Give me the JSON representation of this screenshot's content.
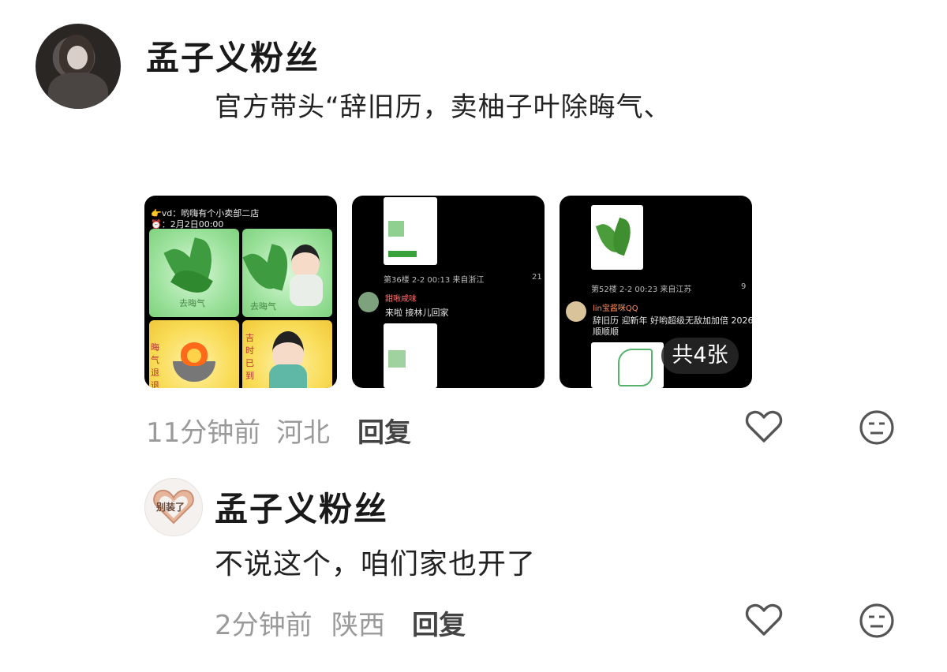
{
  "comments": [
    {
      "username": "孟子义粉丝",
      "text": "官方带头“辞旧历，卖柚子叶除晦气、",
      "time": "11分钟前",
      "location": "河北",
      "reply_label": "回复",
      "image_count_badge": "共4张",
      "thumbnails": {
        "t1": {
          "header_line1": "👉vd：哟嗨有个小卖部二店",
          "header_line2": "⏰：2月2日00:00",
          "cell_labels": [
            "去晦气",
            "去晦气",
            "晦气退退退",
            "吉时已到"
          ]
        },
        "t2": {
          "post_meta": "第36楼 2-2 00:13 来自浙江",
          "likes": "21",
          "reply_user": "甜啾咸味",
          "reply_text": "来啦 接林儿回家"
        },
        "t3": {
          "post_meta": "第52楼 2-2 00:23 来自江苏",
          "likes": "9",
          "reply_user": "lin宝酱咪QQ",
          "reply_text_line1": "辞旧历 迎新年 好哟超级无敌加加倍 2026",
          "reply_text_line2": "顺顺顺"
        }
      }
    },
    {
      "username": "孟子义粉丝",
      "avatar_text": "别装了",
      "text": "不说这个，咱们家也开了",
      "time": "2分钟前",
      "location": "陕西",
      "reply_label": "回复"
    }
  ],
  "icons": {
    "like": "heart-outline-icon",
    "emoji": "neutral-face-icon"
  },
  "colors": {
    "meta_text": "#9a9a9a",
    "username": "#1a1a1a",
    "thumbnail_bg": "#000000",
    "badge_bg": "#282828"
  }
}
